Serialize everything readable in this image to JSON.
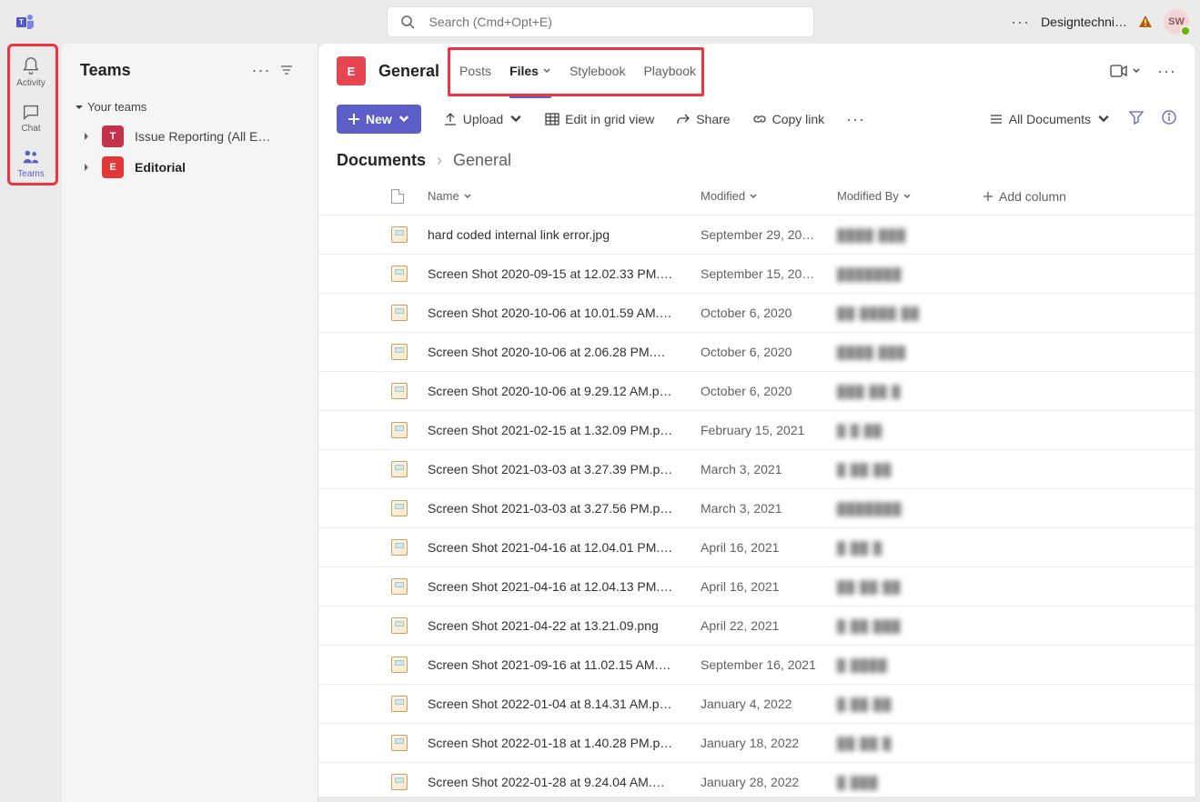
{
  "topbar": {
    "search_placeholder": "Search (Cmd+Opt+E)",
    "user_label": "Designtechni…",
    "avatar_initials": "SW"
  },
  "rail": {
    "items": [
      {
        "label": "Activity"
      },
      {
        "label": "Chat"
      },
      {
        "label": "Teams"
      }
    ]
  },
  "sidebar": {
    "title": "Teams",
    "section_label": "Your teams",
    "teams": [
      {
        "initial": "T",
        "name": "Issue Reporting (All E…"
      },
      {
        "initial": "E",
        "name": "Editorial"
      }
    ]
  },
  "channel": {
    "avatar_initial": "E",
    "name": "General",
    "tabs": [
      {
        "label": "Posts"
      },
      {
        "label": "Files"
      },
      {
        "label": "Stylebook"
      },
      {
        "label": "Playbook"
      }
    ]
  },
  "toolbar": {
    "new_label": "New",
    "upload_label": "Upload",
    "grid_label": "Edit in grid view",
    "share_label": "Share",
    "copy_label": "Copy link",
    "view_label": "All Documents"
  },
  "breadcrumb": {
    "root": "Documents",
    "current": "General"
  },
  "columns": {
    "name": "Name",
    "modified": "Modified",
    "modified_by": "Modified By",
    "add": "Add column"
  },
  "files": [
    {
      "name": "hard coded internal link error.jpg",
      "modified": "September 29, 20…",
      "by": "████ ███"
    },
    {
      "name": "Screen Shot 2020-09-15 at 12.02.33 PM.…",
      "modified": "September 15, 20…",
      "by": "███████"
    },
    {
      "name": "Screen Shot 2020-10-06 at 10.01.59 AM.…",
      "modified": "October 6, 2020",
      "by": "██ ████ ██"
    },
    {
      "name": "Screen Shot 2020-10-06 at 2.06.28 PM.…",
      "modified": "October 6, 2020",
      "by": "████ ███"
    },
    {
      "name": "Screen Shot 2020-10-06 at 9.29.12 AM.p…",
      "modified": "October 6, 2020",
      "by": "███  ██ █"
    },
    {
      "name": "Screen Shot 2021-02-15 at 1.32.09 PM.p…",
      "modified": "February 15, 2021",
      "by": "█ █ ██"
    },
    {
      "name": "Screen Shot 2021-03-03 at 3.27.39 PM.p…",
      "modified": "March 3, 2021",
      "by": "█ ██ ██"
    },
    {
      "name": "Screen Shot 2021-03-03 at 3.27.56 PM.p…",
      "modified": "March 3, 2021",
      "by": "███████"
    },
    {
      "name": "Screen Shot 2021-04-16 at 12.04.01 PM.…",
      "modified": "April 16, 2021",
      "by": "█  ██ █"
    },
    {
      "name": "Screen Shot 2021-04-16 at 12.04.13 PM.…",
      "modified": "April 16, 2021",
      "by": "██ ██  ██"
    },
    {
      "name": "Screen Shot 2021-04-22 at 13.21.09.png",
      "modified": "April 22, 2021",
      "by": "█ ██ ███"
    },
    {
      "name": "Screen Shot 2021-09-16 at 11.02.15 AM.…",
      "modified": "September 16, 2021",
      "by": "█ ████"
    },
    {
      "name": "Screen Shot 2022-01-04 at 8.14.31 AM.p…",
      "modified": "January 4, 2022",
      "by": "█ ██ ██"
    },
    {
      "name": "Screen Shot 2022-01-18 at 1.40.28 PM.p…",
      "modified": "January 18, 2022",
      "by": "██ ██ █"
    },
    {
      "name": "Screen Shot 2022-01-28 at 9.24.04 AM.…",
      "modified": "January 28, 2022",
      "by": "█  ███"
    }
  ]
}
